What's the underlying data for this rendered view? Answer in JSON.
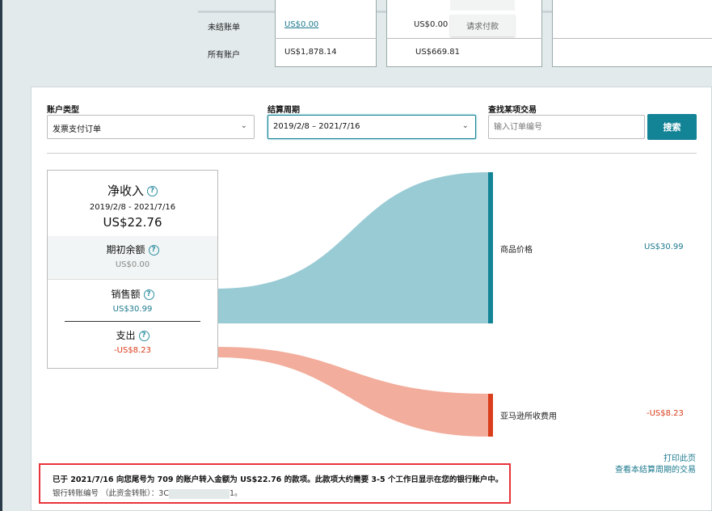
{
  "summary_table": {
    "rows": [
      {
        "label": "未结账单",
        "col1": "US$0.00",
        "col2": "US$0.00",
        "button": "请求付款"
      },
      {
        "label": "所有账户",
        "col1": "US$1,878.14",
        "col2": "US$669.81"
      }
    ]
  },
  "filters": {
    "account_type_label": "账户类型",
    "account_type_value": "发票支付订单",
    "period_label": "结算周期",
    "period_value": "2019/2/8 – 2021/7/16",
    "search_label": "查找某项交易",
    "search_placeholder": "输入订单编号",
    "search_button": "搜索"
  },
  "summary": {
    "title": "净收入",
    "period": "2019/2/8 - 2021/7/16",
    "net": "US$22.76",
    "opening_label": "期初余额",
    "opening_value": "US$0.00",
    "sales_label": "销售额",
    "sales_value": "US$30.99",
    "expense_label": "支出",
    "expense_value": "-US$8.23"
  },
  "flows": [
    {
      "label": "商品价格",
      "value": "US$30.99",
      "amount": 30.99,
      "color": "#99cbd4",
      "bar": "#138396"
    },
    {
      "label": "亚马逊所收费用",
      "value": "-US$8.23",
      "amount": 8.23,
      "color": "#f2ad9c",
      "bar": "#d93d1b"
    }
  ],
  "links": {
    "print": "打印此页",
    "view": "查看本结算周期的交易"
  },
  "notice": {
    "line1": "已于 2021/7/16 向您尾号为 709 的账户转入金额为 US$22.76 的款项。此款项大约需要 3-5 个工作日显示在您的银行账户中。",
    "ref_label": "银行转账编号 （此资金转账）：",
    "ref_start": "3C",
    "ref_end": "1。"
  }
}
